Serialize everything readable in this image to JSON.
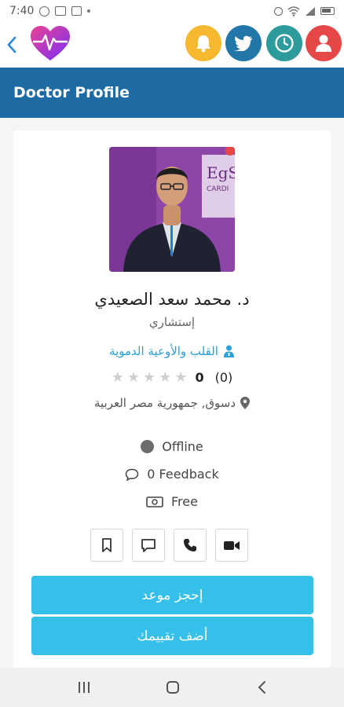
{
  "status_bar": {
    "time": "7:40"
  },
  "header": {
    "title": "Doctor Profile"
  },
  "doctor": {
    "name": "د. محمد سعد الصعيدي",
    "title": "إستشاري",
    "specialty": "القلب والأوعية الدموية",
    "rating_score": "0",
    "rating_count": "(0)",
    "stars_filled": 0,
    "stars_total": 5,
    "location": "دسوق, جمهورية مصر العربية"
  },
  "info": {
    "status": "Offline",
    "feedback": "0 Feedback",
    "fee": "Free"
  },
  "buttons": {
    "book": "إحجز موعد",
    "review": "أضف تقييمك"
  },
  "photo_text": {
    "line1": "EgS",
    "line2": "CARDI"
  },
  "colors": {
    "header_band": "#1e6aa3",
    "primary_button": "#35c0ea",
    "specialty_text": "#2a9fd8",
    "bell": "#f5b82e",
    "bird": "#2276a8",
    "clock": "#2d9b9b",
    "user": "#e64848"
  },
  "icons": {
    "top_bar": [
      "back-icon",
      "heart-logo-icon",
      "bell-icon",
      "bird-icon",
      "clock-icon",
      "user-icon"
    ],
    "actions": [
      "bookmark-icon",
      "chat-icon",
      "phone-icon",
      "video-icon"
    ]
  }
}
